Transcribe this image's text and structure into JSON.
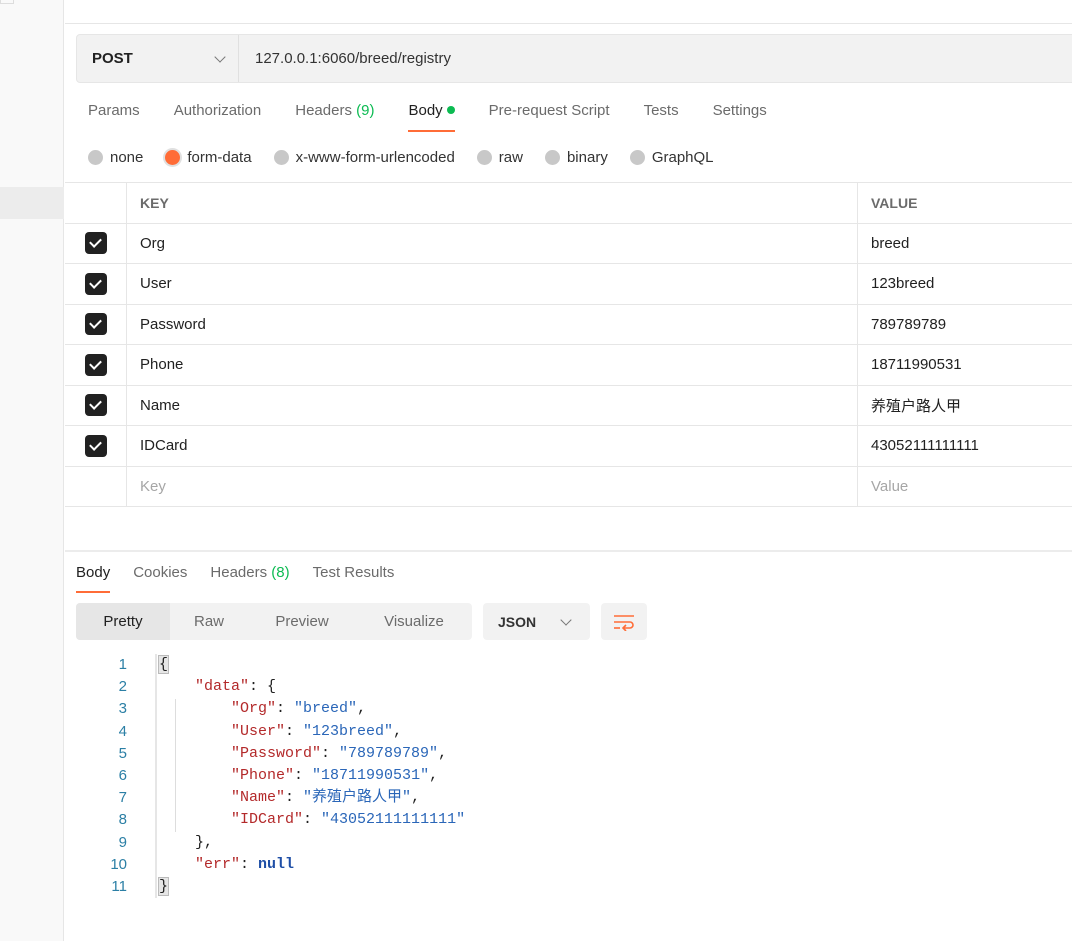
{
  "request": {
    "method": "POST",
    "url": "127.0.0.1:6060/breed/registry"
  },
  "tabs": [
    {
      "label": "Params"
    },
    {
      "label": "Authorization"
    },
    {
      "label": "Headers",
      "count": "(9)"
    },
    {
      "label": "Body",
      "active": true
    },
    {
      "label": "Pre-request Script"
    },
    {
      "label": "Tests"
    },
    {
      "label": "Settings"
    }
  ],
  "body_types": [
    {
      "label": "none"
    },
    {
      "label": "form-data",
      "selected": true
    },
    {
      "label": "x-www-form-urlencoded"
    },
    {
      "label": "raw"
    },
    {
      "label": "binary"
    },
    {
      "label": "GraphQL"
    }
  ],
  "table": {
    "headers": [
      "KEY",
      "VALUE"
    ],
    "rows": [
      {
        "key": "Org",
        "value": "breed"
      },
      {
        "key": "User",
        "value": "123breed"
      },
      {
        "key": "Password",
        "value": "789789789"
      },
      {
        "key": "Phone",
        "value": "18711990531"
      },
      {
        "key": "Name",
        "value": "养殖户路人甲"
      },
      {
        "key": "IDCard",
        "value": "43052111111111"
      }
    ],
    "placeholder": {
      "key": "Key",
      "value": "Value"
    }
  },
  "response": {
    "tabs": [
      {
        "label": "Body",
        "active": true
      },
      {
        "label": "Cookies"
      },
      {
        "label": "Headers",
        "count": "(8)"
      },
      {
        "label": "Test Results"
      }
    ],
    "views": [
      "Pretty",
      "Raw",
      "Preview",
      "Visualize"
    ],
    "format": "JSON",
    "lines": [
      "1",
      "2",
      "3",
      "4",
      "5",
      "6",
      "7",
      "8",
      "9",
      "10",
      "11"
    ],
    "json": {
      "data": {
        "Org": "breed",
        "User": "123breed",
        "Password": "789789789",
        "Phone": "18711990531",
        "Name": "养殖户路人甲",
        "IDCard": "43052111111111"
      },
      "err": "null"
    }
  },
  "colors": {
    "accent": "#ff6c37",
    "green": "#0cbb52"
  }
}
